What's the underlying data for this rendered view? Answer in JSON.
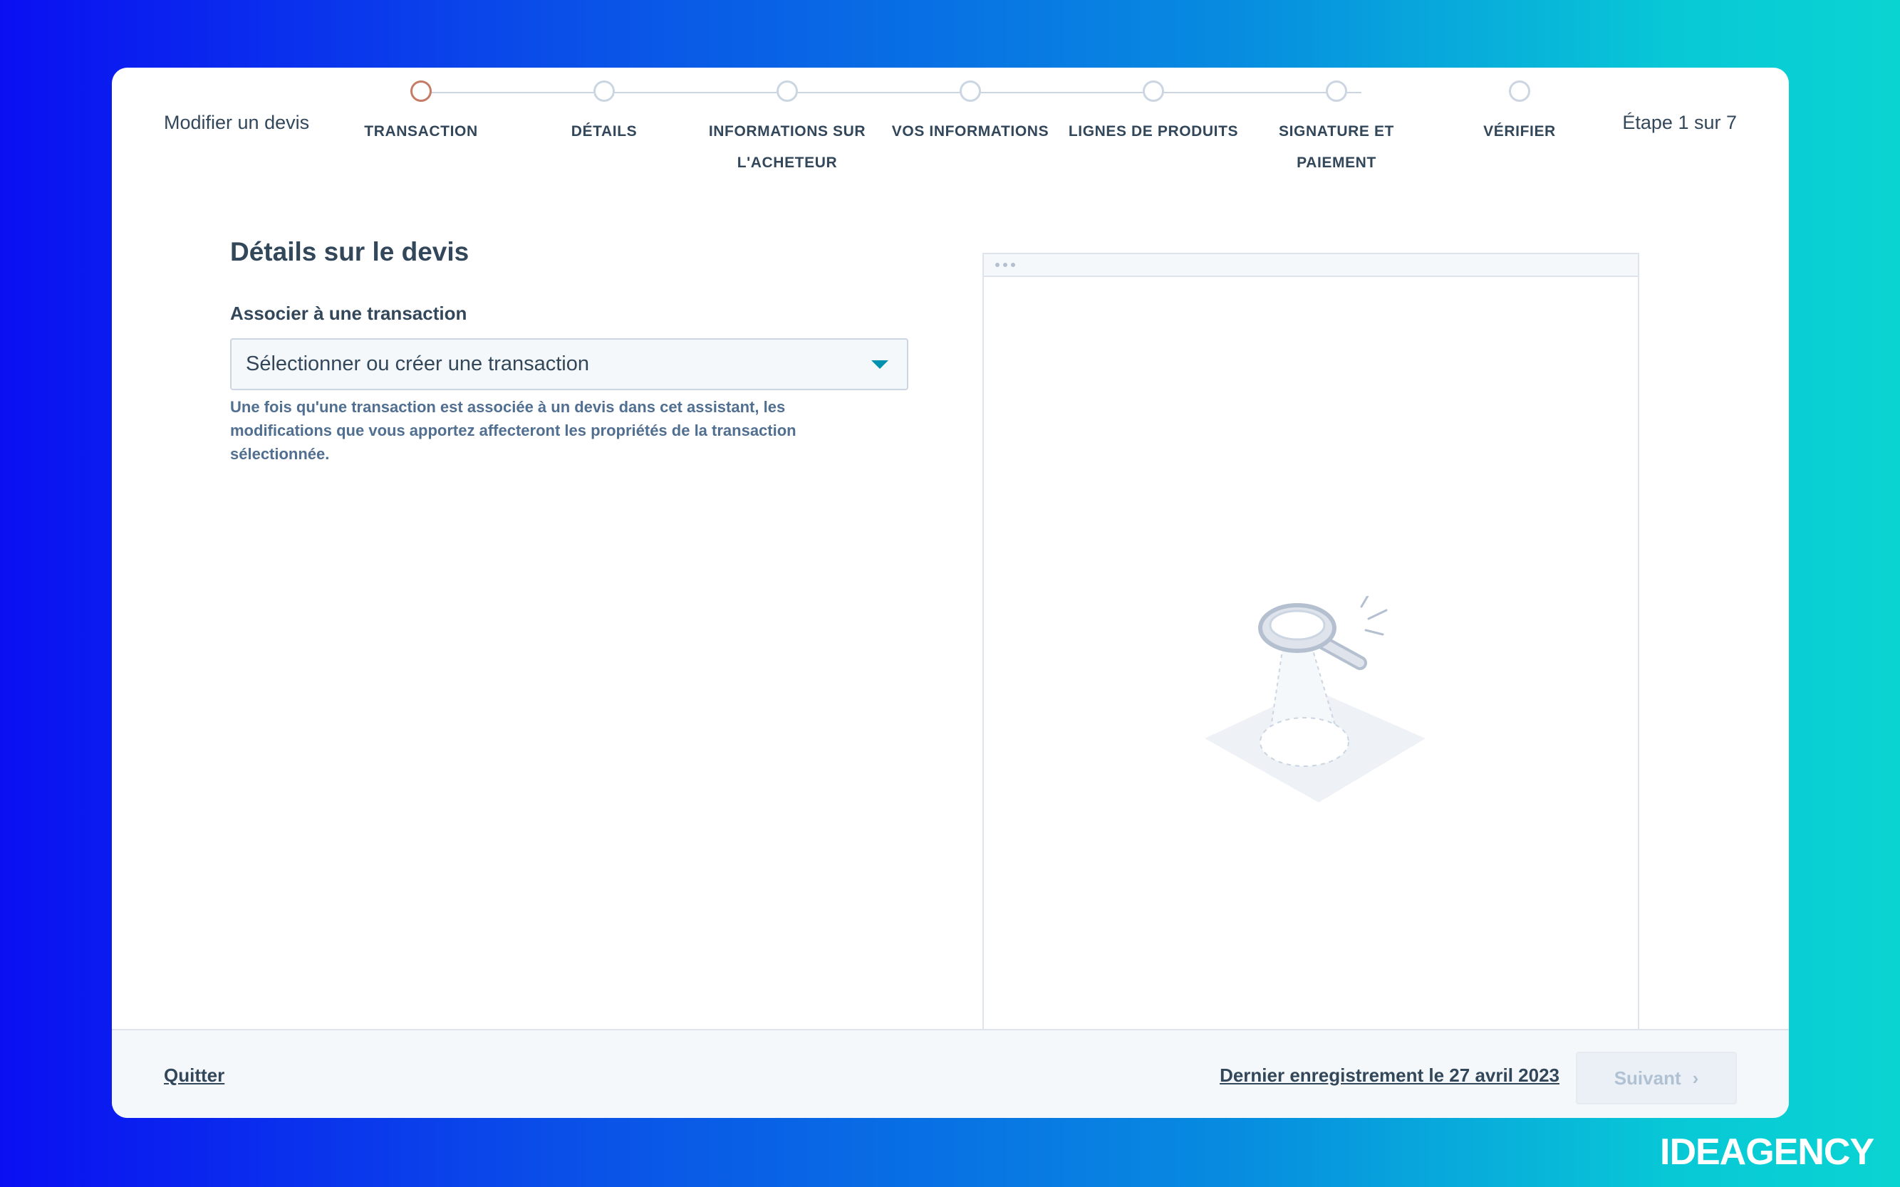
{
  "wizard": {
    "title": "Modifier un devis",
    "step_counter": "Étape 1 sur 7",
    "steps": [
      {
        "label": "TRANSACTION",
        "active": true
      },
      {
        "label": "DÉTAILS",
        "active": false
      },
      {
        "label": "INFORMATIONS SUR L'ACHETEUR",
        "active": false
      },
      {
        "label": "VOS INFORMATIONS",
        "active": false
      },
      {
        "label": "LIGNES DE PRODUITS",
        "active": false
      },
      {
        "label": "SIGNATURE ET PAIEMENT",
        "active": false
      },
      {
        "label": "VÉRIFIER",
        "active": false
      }
    ]
  },
  "main": {
    "section_title": "Détails sur le devis",
    "field_label": "Associer à une transaction",
    "select_value": "Sélectionner ou créer une transaction",
    "help_text": "Une fois qu'une transaction est associée à un devis dans cet assistant, les modifications que vous apportez affecteront les propriétés de la transaction sélectionnée."
  },
  "preview": {
    "illustration_icon": "magnifier-illustration-icon"
  },
  "footer": {
    "quit_label": "Quitter",
    "last_saved": "Dernier enregistrement le 27 avril 2023",
    "next_label": "Suivant",
    "next_icon": "chevron-right-icon"
  },
  "brand": {
    "text": "IDEAGENCY"
  },
  "colors": {
    "active_step": "#c57b66",
    "accent": "#0091ae",
    "text": "#33475b"
  }
}
